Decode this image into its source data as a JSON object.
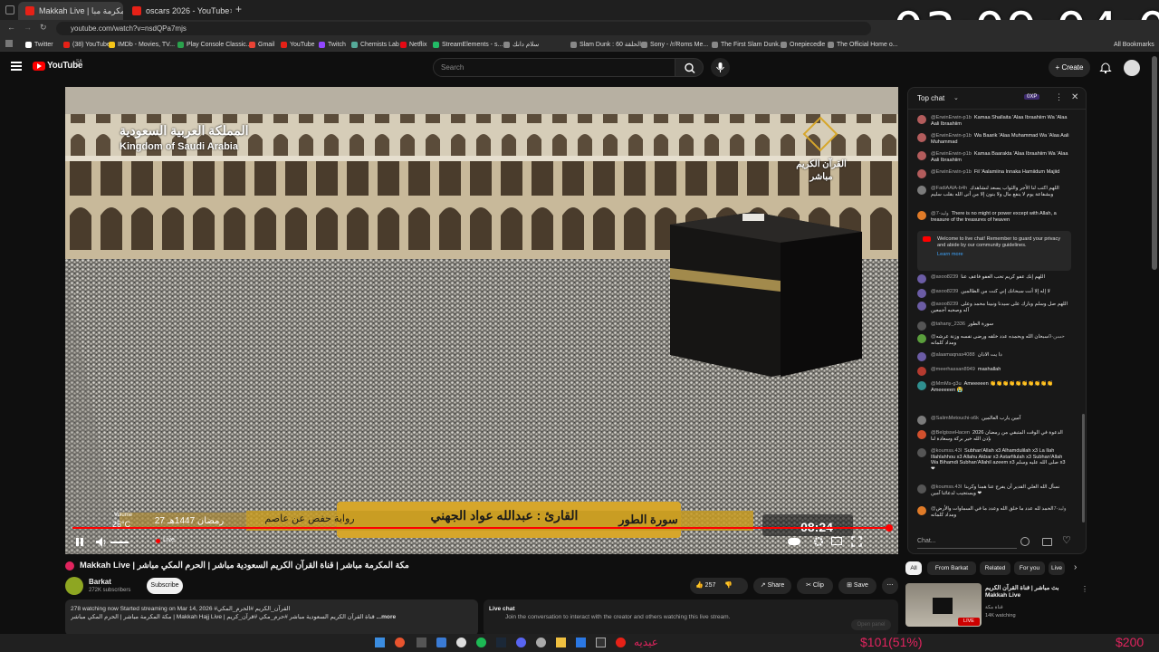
{
  "browser": {
    "tabs": [
      {
        "label": "Makkah Live | مكة المكرمة مبا"
      },
      {
        "label": "oscars 2026 - YouTube"
      }
    ],
    "new_tab": "+",
    "url": "youtube.com/watch?v=nsdQPa7mjs",
    "bookmarks": [
      "Twitter",
      "(38) YouTube",
      "IMDb - Movies, TV...",
      "Play Console Classic...",
      "Gmail",
      "YouTube",
      "Twitch",
      "Chemists Lab",
      "Netflix",
      "StreamElements - s...",
      "سلام دانك",
      "Slam Dunk | سلام دانك",
      "Slam Dunk : 60 الحلقة",
      "Sony - /r/Roms Me...",
      "The First Slam Dunk...",
      "Onepiecedle",
      "The Official Home o...",
      "All Bookmarks"
    ]
  },
  "stream_overlay": {
    "timer": "03:09:04:02",
    "donor_name": "عيديه",
    "goal_progress": "$101(51%)",
    "goal_target": "$200"
  },
  "youtube": {
    "logo": "YouTube",
    "region": "SA",
    "search_placeholder": "Search",
    "create_label": "Create"
  },
  "video": {
    "channel_tag_ar": "المملكة العربية السعودية",
    "channel_tag_en": "Kingdom of Saudi Arabia",
    "logo_text_1": "القرآن الكريم",
    "logo_text_2": "مباشر",
    "banner_surah": "سورة الطور",
    "banner_reader": "القارئ : عبدالله عواد الجهني",
    "banner_riwaya": "رواية حفص عن عاصم",
    "banner_date": "27 رمضان 1447هـ",
    "banner_time": "08:24",
    "temperature": "25°C",
    "volume_tooltip": "Volume",
    "live_label": "Live",
    "progress": 1.0
  },
  "chat": {
    "header": "Top chat",
    "points": "0XP",
    "notice": "Welcome to live chat! Remember to guard your privacy and abide by our community guidelines.",
    "learn_more": "Learn more",
    "input_placeholder": "Chat...",
    "messages": [
      {
        "author": "@ErwinErwin-p1b",
        "text": "Kamaa Shallaita 'Alaa Ibraahiim Wa 'Alaa Aali Ibraahiim",
        "color": "#b35c5c"
      },
      {
        "author": "@ErwinErwin-p1b",
        "text": "Wa Baarik 'Alaa Muhammad Wa 'Alaa Aali Muhammad",
        "color": "#b35c5c"
      },
      {
        "author": "@ErwinErwin-p1b",
        "text": "Kamaa Baarakta 'Alaa Ibraahiim Wa 'Alaa Aali Ibraahiim",
        "color": "#b35c5c"
      },
      {
        "author": "@ErwinErwin-p1b",
        "text": "Fil 'Aalamiina Innaka Hamiidum Majiid",
        "color": "#b35c5c"
      },
      {
        "author": "@FadiAAlA-b4h",
        "text": "اللهم اكتب لنا الأجر والثواب يسعد لنشاهدك وبشفاعة يوم لا ينفع مال ولا بنون إلا من أتى الله بقلب سليم",
        "color": "#7b7b7b"
      },
      {
        "author": "@وليد-7",
        "text": "There is no might or power except with Allah, a treasure of the treasures of heaven",
        "color": "#e07b28"
      },
      {
        "author": "@asoo8239",
        "text": "اللهم إنك عفو كريم تحب العفو فاعف عنا",
        "color": "#6b5ca5"
      },
      {
        "author": "@asoo8239",
        "text": "لا إله إلا أنت سبحانك إني كنت من الظالمين",
        "color": "#6b5ca5"
      },
      {
        "author": "@asoo8239",
        "text": "اللهم صل وسلم وبارك على سيدنا ونبينا محمد وعلى آله وصحبه أجمعين",
        "color": "#6b5ca5"
      },
      {
        "author": "@tahany_2336",
        "text": "سورة الطور",
        "color": "#555"
      },
      {
        "author": "@حسن-9",
        "text": "سبحان الله وبحمده عدد خلقه ورضى نفسه وزنة عرشه ومداد كلماته",
        "color": "#5a9e3c"
      },
      {
        "author": "@alaamaqnas4088",
        "text": "دا يت الاذان",
        "color": "#6b5ca5"
      },
      {
        "author": "@meerhassan8949",
        "text": "mashallah",
        "color": "#b53a2f"
      },
      {
        "author": "@MmMs-g3u",
        "text": "Ameeeeen 👏👏👏👏👏👏👏👏👏👏 Ameeeeen 😭",
        "color": "#2f8f8f"
      },
      {
        "author": "@SalimMetouchi-s6k",
        "text": "آمين يارب العالمين",
        "color": "#7b7b7b"
      },
      {
        "author": "@BelgisseHacen",
        "text": "الدعوة في الوقت المتبقي من رمضان 2026 بإذن الله خير بركة وسعادة لنا",
        "color": "#d2502d"
      },
      {
        "author": "@koumss.43l",
        "text": "Subhan'Allah x3 Alhamdulilah x3 La Ilah Illahlahhou x3 Allahu Akbar x3 Astarfilulah x3 Subhan'Allah Wa Bihamdi Subhan'Allahil azeem x3 صلى الله عليه وسلم x3 ❤",
        "color": "#555"
      },
      {
        "author": "@koumss.43l",
        "text": "نسأل الله العلي القدير أن يفرج عنا همنا وكربنا ويستجيب لدعائنا آمين ❤",
        "color": "#555"
      },
      {
        "author": "@وليد-7",
        "text": "الحمد لله عدد ما خلق الله وعدد ما في السماوات والأرض ومداد كلماته",
        "color": "#e07b28"
      }
    ]
  },
  "below": {
    "title": "Makkah Live | مكة المكرمة مباشر | قناة القرآن الكريم السعودية مباشر | الحرم المكي مباشر",
    "channel": "Barkat",
    "subscribers": "272K subscribers",
    "subscribe_label": "Subscribe",
    "likes": "257",
    "share_label": "Share",
    "clip_label": "Clip",
    "save_label": "Save",
    "description_line1": "278 watching now  Started streaming on Mar 14, 2026  #القرآن_الكريم #الحرم_المكي",
    "description_line2": "مكة المكرمة مباشر | الحرم المكي مباشر | Makkah Hajj Live | قناة القرآن الكريم السعودية مباشر  #حرم_مكي #قرآن_كريم",
    "more_label": "...more",
    "live_chat_title": "Live chat",
    "live_chat_text": "Join the conversation to interact with the creator and others watching this live stream.",
    "open_panel": "Open panel",
    "filters": [
      "All",
      "From Barkat",
      "Related",
      "For you",
      "Live"
    ],
    "reco_title": "بث مباشر | قناة القرآن الكريم Makkah Live",
    "reco_channel": "قناة مكة",
    "reco_meta": "14K watching",
    "reco_badge": "LIVE"
  },
  "colors": {
    "accent_red": "#ff0000",
    "donation": "#e0245e",
    "banner_gold": "#d6a62b"
  }
}
